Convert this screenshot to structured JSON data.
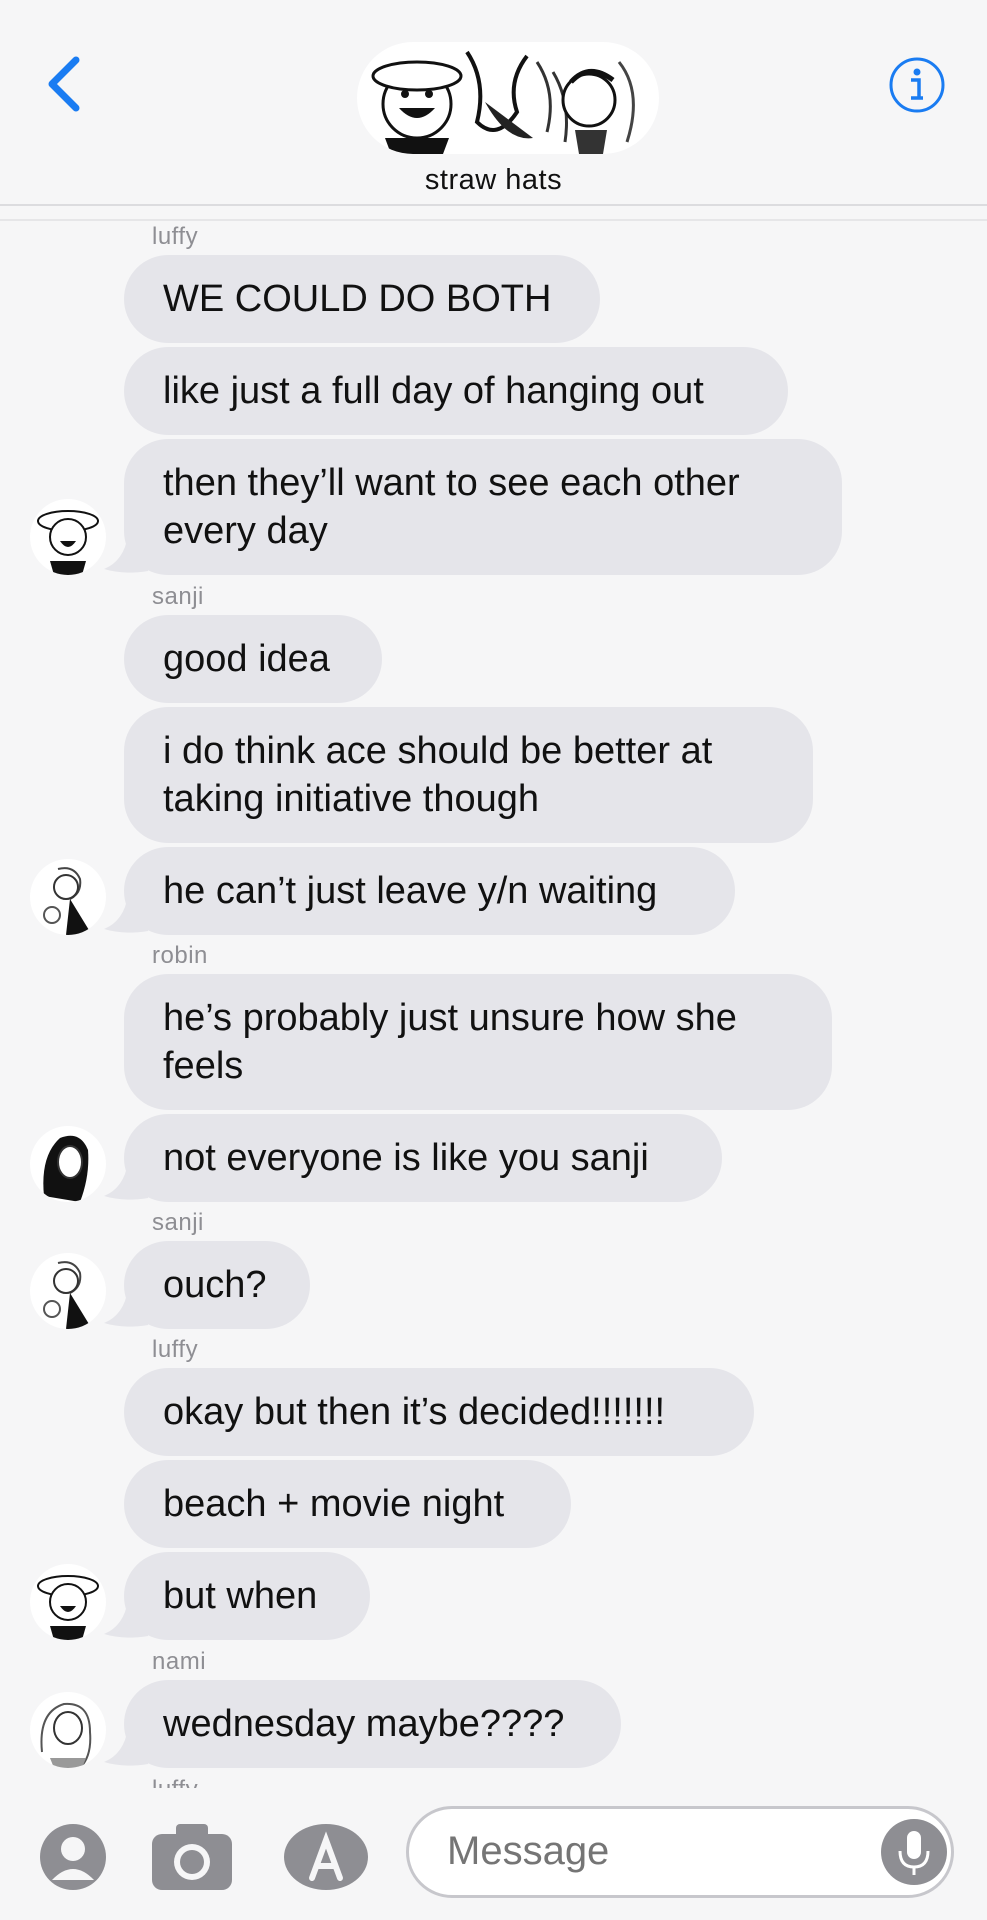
{
  "header": {
    "group_name": "straw hats",
    "accent": "#1a7cf2"
  },
  "messages": [
    {
      "sender": "luffy"
    },
    {
      "text": "WE COULD DO BOTH"
    },
    {
      "text": "like just a full day of hanging out"
    },
    {
      "text": "then they’ll want to see each other every day"
    },
    {
      "sender": "sanji"
    },
    {
      "text": "good idea"
    },
    {
      "text": "i do think ace should be better at taking initiative though"
    },
    {
      "text": "he can’t just leave y/n waiting"
    },
    {
      "sender": "robin"
    },
    {
      "text": "he’s probably just unsure how she feels"
    },
    {
      "text": "not everyone is like you sanji"
    },
    {
      "sender": "sanji"
    },
    {
      "text": "ouch?"
    },
    {
      "sender": "luffy"
    },
    {
      "text": "okay but then it’s decided!!!!!!!"
    },
    {
      "text": "beach + movie night"
    },
    {
      "text": "but when"
    },
    {
      "sender": "nami"
    },
    {
      "text": "wednesday maybe????"
    },
    {
      "sender": "luffy"
    }
  ],
  "input": {
    "placeholder": "Message"
  },
  "icons": {
    "back": "chevron-left-icon",
    "info": "info-icon",
    "contacts": "person-icon",
    "camera": "camera-icon",
    "appstore": "app-store-icon",
    "mic": "microphone-icon"
  },
  "colors": {
    "bubble": "#e5e5ea",
    "background": "#f6f6f7",
    "sender_label": "#8e8e93"
  }
}
